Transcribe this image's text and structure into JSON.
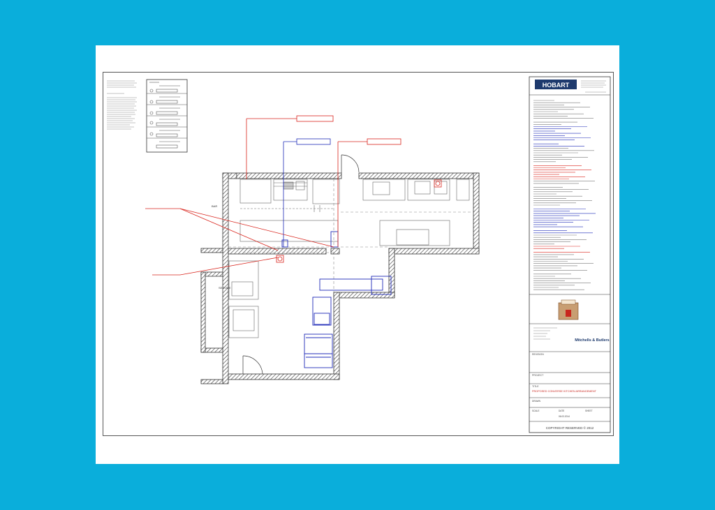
{
  "colors": {
    "background": "#0aaedb",
    "red_annotation": "#d9241c",
    "blue_equipment": "#1e2bb8",
    "wall_hatch": "#444444",
    "hobart_navy": "#1e3a6d"
  },
  "title_block": {
    "brand": "HOBART",
    "client_name": "Mitchells & Butlers",
    "project_label": "PROJECT",
    "title_label": "TITLE",
    "title": "PROPOSED CONVERSE KITCHEN ARRANGEMENT",
    "revision_label": "REVISION",
    "drawn_by_label": "DRAWN",
    "date_label": "DATE",
    "scale_label": "SCALE",
    "sheet_label": "SHEET",
    "date": "06.03.2014",
    "copyright": "COPYRIGHT RESERVED © 2012"
  },
  "plan_labels": {
    "left_upper": "BAR",
    "left_lower": "SERVICE"
  }
}
